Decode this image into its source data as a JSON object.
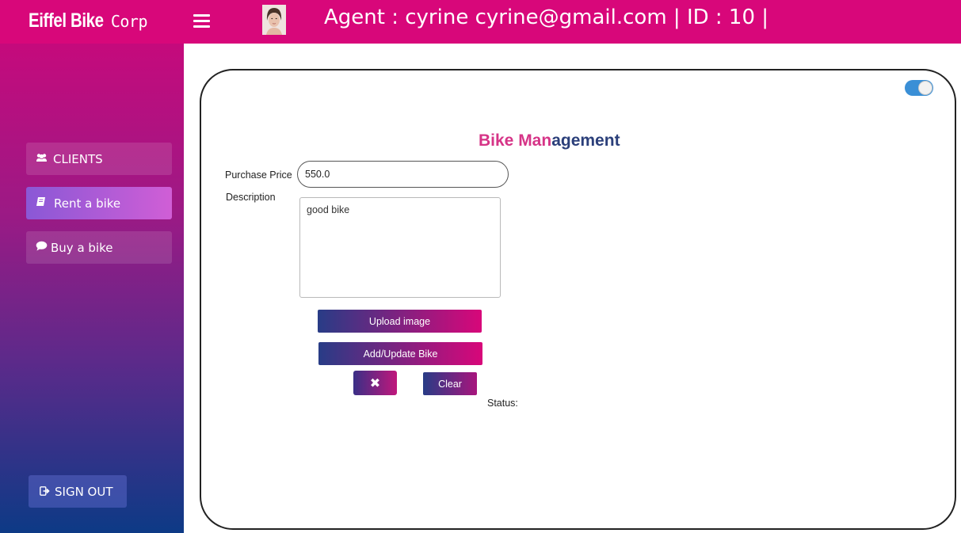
{
  "header": {
    "brand_bold": "Eiffel Bike",
    "brand_light": "Corp",
    "agent_text": "Agent : cyrine cyrine@gmail.com | ID : 10 |",
    "menu_icon": "hamburger-icon",
    "avatar_icon": "user-avatar"
  },
  "sidebar": {
    "items": [
      {
        "label": "CLIENTS",
        "icon": "users-icon"
      },
      {
        "label": "Rent a bike",
        "icon": "book-icon",
        "active": true
      },
      {
        "label": "Buy a bike",
        "icon": "comment-icon"
      }
    ],
    "signout_label": "SIGN OUT",
    "signout_icon": "sign-out-icon"
  },
  "main": {
    "title_part1": "Bike Man",
    "title_part2": "agement",
    "price_label": "Purchase Price",
    "price_value": "550.0",
    "description_label": "Description",
    "description_value": "good bike",
    "upload_label": "Upload image",
    "add_update_label": "Add/Update Bike",
    "delete_icon": "close-icon",
    "delete_glyph": "✖",
    "clear_label": "Clear",
    "status_label": "Status:",
    "toggle_state": "on"
  },
  "colors": {
    "topbar": "#d8077a",
    "sidebar_top": "#c50a7c",
    "sidebar_bottom": "#0d3a86",
    "title_pink": "#d63487",
    "title_navy": "#2b3f7a"
  }
}
